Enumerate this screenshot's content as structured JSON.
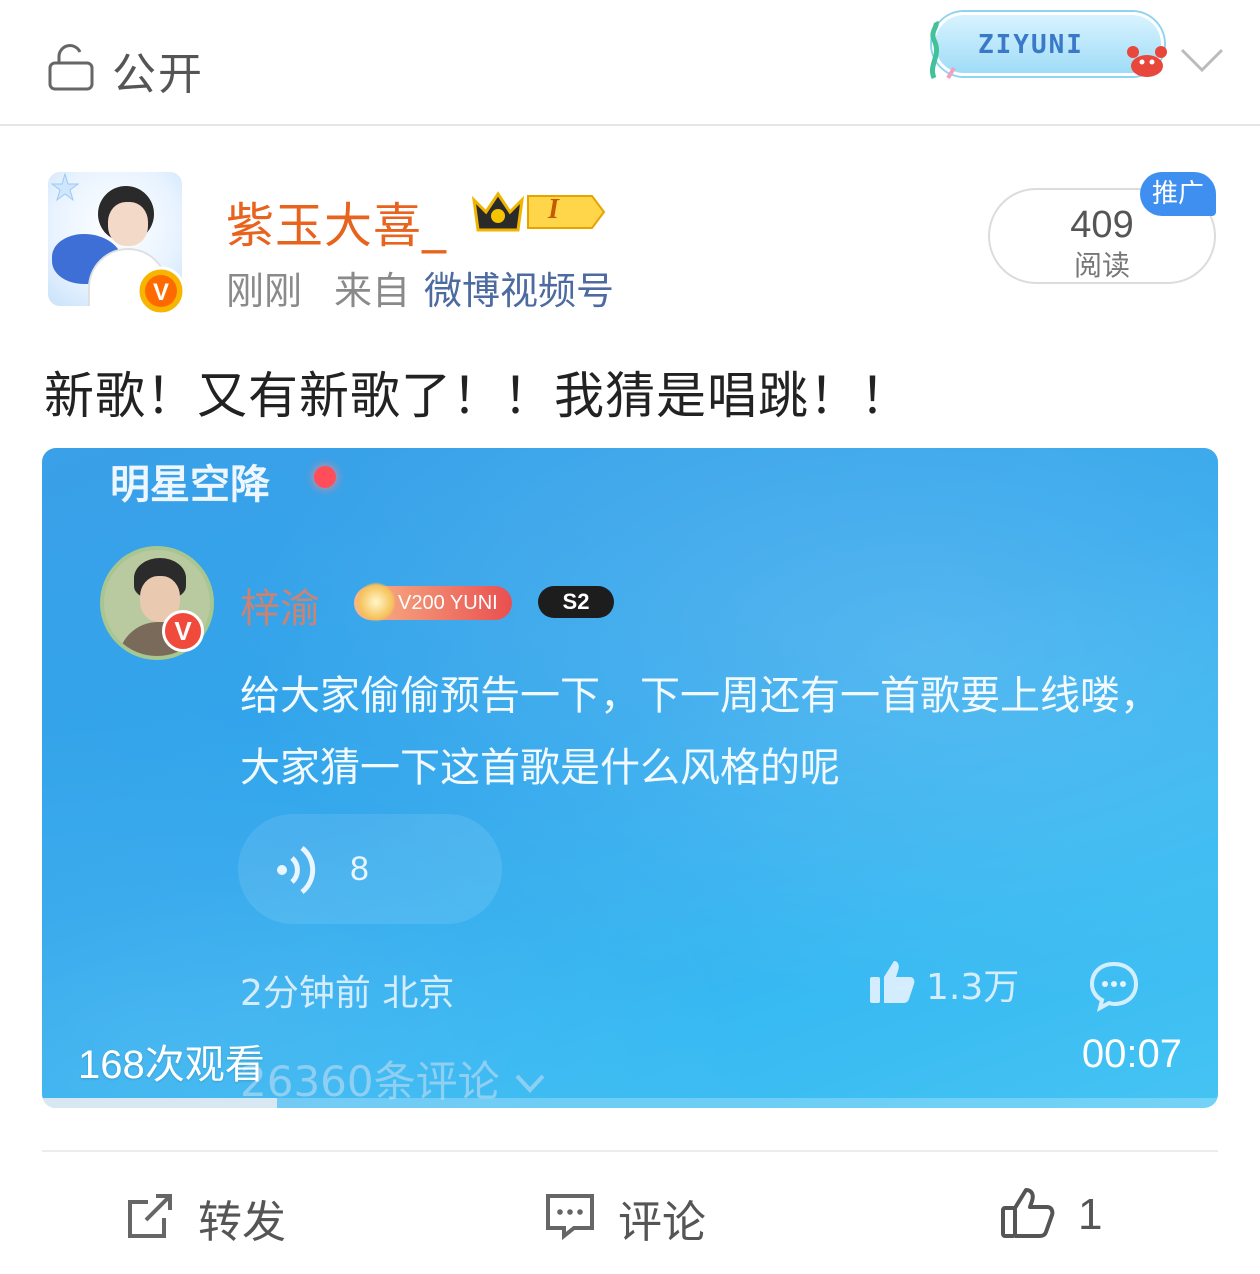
{
  "topbar": {
    "privacy_label": "公开",
    "badge_text": "ZIYUNI"
  },
  "post": {
    "username": "紫玉大喜_",
    "level_badge": "I",
    "time": "刚刚",
    "from_label": "来自",
    "source": "微博视频号",
    "read_count": "409",
    "read_label": "阅读",
    "promo_label": "推广",
    "text": "新歌！又有新歌了！！我猜是唱跳！！"
  },
  "video": {
    "header": "明星空降",
    "author": "梓渝",
    "tag_v": "V200 YUNI",
    "tag_s": "S2",
    "verified_mark": "V",
    "message": "给大家偷偷预告一下，下一周还有一首歌要上线喽，大家猜一下这首歌是什么风格的呢",
    "voice_duration": "8",
    "post_time": "2分钟前 北京",
    "like_count": "1.3万",
    "comments_label": "26360条评论",
    "views": "168次观看",
    "duration": "00:07",
    "progress": 0.2
  },
  "actions": {
    "repost_label": "转发",
    "comment_label": "评论",
    "like_count": "1"
  },
  "colors": {
    "username": "#e8631e",
    "source_link": "#4d6ba0",
    "promo_bg": "#3f8ff0",
    "video_bg": "#2fa6ec"
  }
}
